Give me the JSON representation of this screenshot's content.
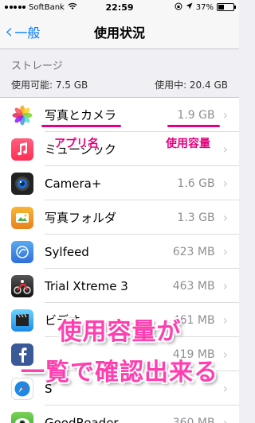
{
  "status_bar": {
    "carrier": "SoftBank",
    "time": "22:59",
    "battery": "37%",
    "battery_fraction": 0.37
  },
  "nav": {
    "back_label": "一般",
    "title": "使用状況"
  },
  "storage": {
    "header": "ストレージ",
    "available": "使用可能: 7.5 GB",
    "used": "使用中: 20.4 GB"
  },
  "apps": [
    {
      "name": "写真とカメラ",
      "size": "1.9 GB",
      "icon": "photos-icon"
    },
    {
      "name": "ミュージック",
      "size": "",
      "icon": "music-icon"
    },
    {
      "name": "Camera+",
      "size": "1.6 GB",
      "icon": "camera-plus-icon"
    },
    {
      "name": "写真フォルダ",
      "size": "1.3 GB",
      "icon": "photo-folder-icon"
    },
    {
      "name": "Sylfeed",
      "size": "623 MB",
      "icon": "sylfeed-icon"
    },
    {
      "name": "Trial Xtreme 3",
      "size": "463 MB",
      "icon": "trial-xtreme-icon"
    },
    {
      "name": "ビデオ",
      "size": "461 MB",
      "icon": "video-icon"
    },
    {
      "name": "",
      "size": "419 MB",
      "icon": "facebook-icon"
    },
    {
      "name": "S",
      "size": "",
      "icon": "safari-icon"
    },
    {
      "name": "GoodReader",
      "size": "360 MB",
      "icon": "goodreader-icon"
    }
  ],
  "annotations": {
    "app_name": "アプリ名",
    "usage": "使用容量",
    "overlay_line1": "使用容量が",
    "overlay_line2": "一覧で確認出来る"
  },
  "colors": {
    "accent": "#007aff",
    "annotation": "#e6007e"
  }
}
